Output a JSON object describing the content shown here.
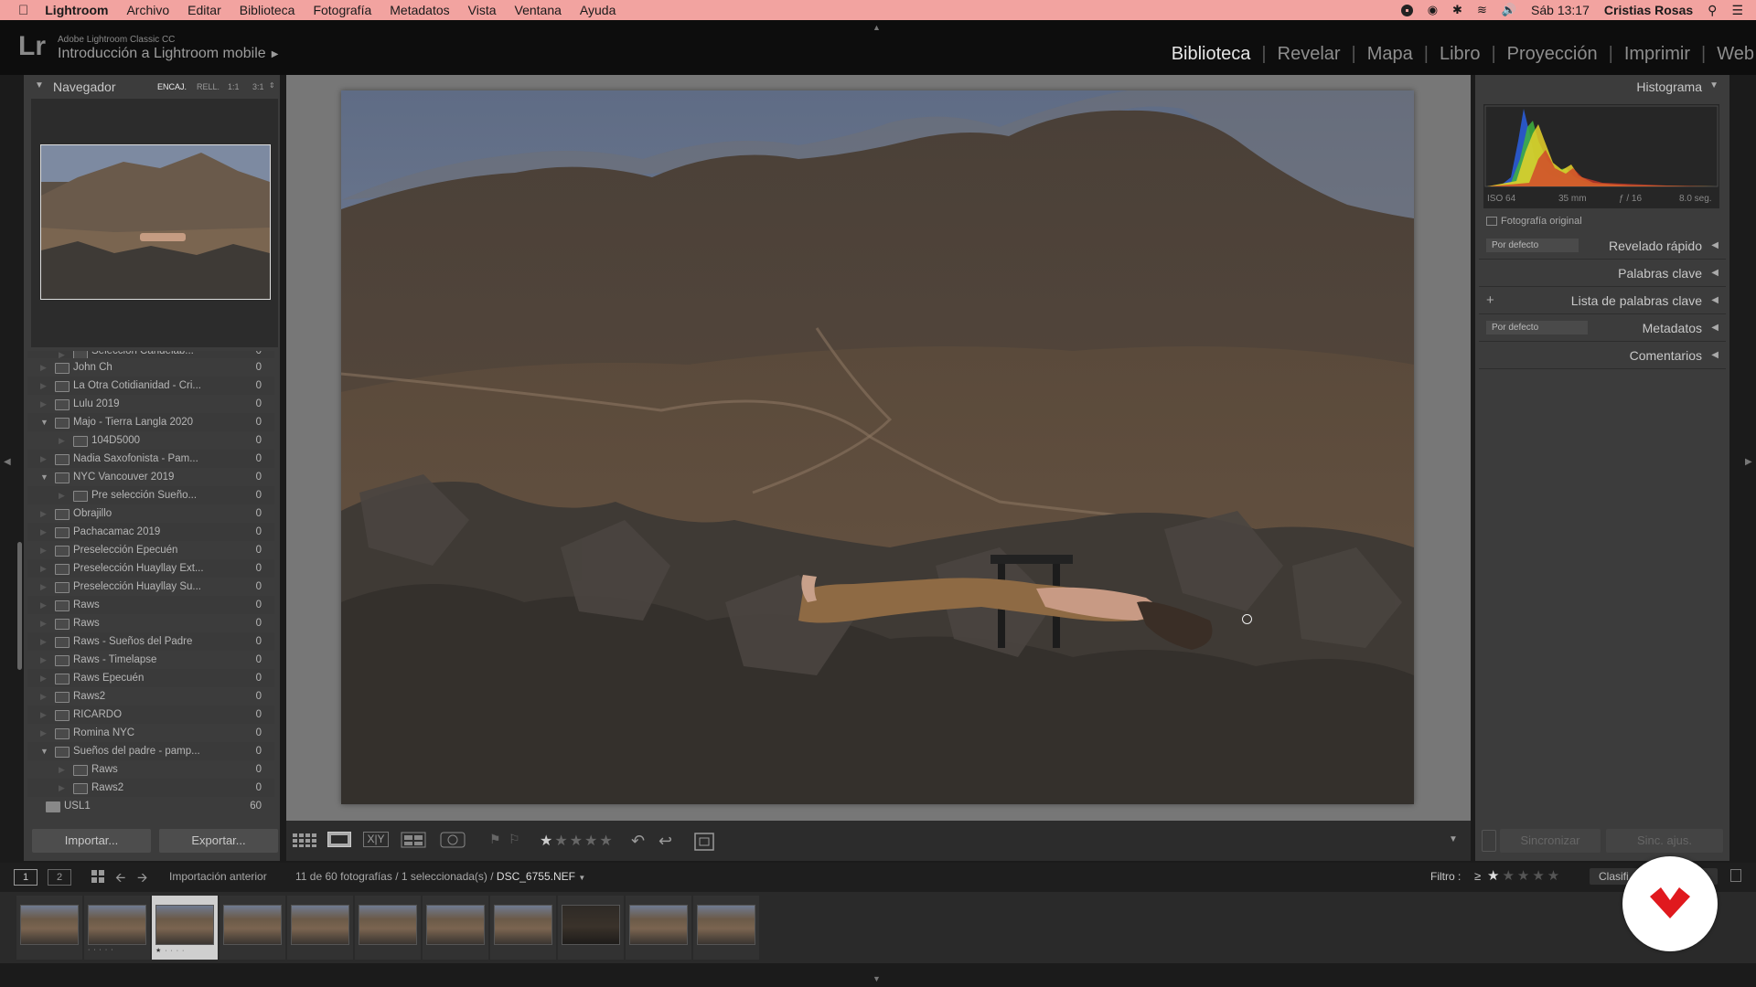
{
  "menubar": {
    "app_name": "Lightroom",
    "items": [
      "Archivo",
      "Editar",
      "Biblioteca",
      "Fotografía",
      "Metadatos",
      "Vista",
      "Ventana",
      "Ayuda"
    ],
    "clock": "Sáb 13:17",
    "user": "Cristias Rosas"
  },
  "header": {
    "logo": "Lr",
    "product": "Adobe Lightroom Classic CC",
    "catalog": "Introducción a Lightroom mobile",
    "modules": [
      "Biblioteca",
      "Revelar",
      "Mapa",
      "Libro",
      "Proyección",
      "Imprimir",
      "Web"
    ],
    "active_module": "Biblioteca"
  },
  "navigator": {
    "title": "Navegador",
    "zoom_options": [
      "ENCAJ.",
      "RELL.",
      "1:1",
      "3:1"
    ]
  },
  "folders": [
    {
      "name": "Selección Candelab...",
      "count": "0",
      "indent": 1,
      "expanded": false,
      "partial": true
    },
    {
      "name": "John Ch",
      "count": "0",
      "indent": 0,
      "expanded": false
    },
    {
      "name": "La Otra Cotidianidad - Cri...",
      "count": "0",
      "indent": 0,
      "expanded": false
    },
    {
      "name": "Lulu 2019",
      "count": "0",
      "indent": 0,
      "expanded": false
    },
    {
      "name": "Majo - Tierra Langla 2020",
      "count": "0",
      "indent": 0,
      "expanded": true
    },
    {
      "name": "104D5000",
      "count": "0",
      "indent": 1,
      "expanded": false
    },
    {
      "name": "Nadia Saxofonista - Pam...",
      "count": "0",
      "indent": 0,
      "expanded": false
    },
    {
      "name": "NYC Vancouver 2019",
      "count": "0",
      "indent": 0,
      "expanded": true
    },
    {
      "name": "Pre selección Sueño...",
      "count": "0",
      "indent": 1,
      "expanded": false
    },
    {
      "name": "Obrajillo",
      "count": "0",
      "indent": 0,
      "expanded": false
    },
    {
      "name": "Pachacamac 2019",
      "count": "0",
      "indent": 0,
      "expanded": false
    },
    {
      "name": "Preselección Epecuén",
      "count": "0",
      "indent": 0,
      "expanded": false
    },
    {
      "name": "Preselección Huayllay Ext...",
      "count": "0",
      "indent": 0,
      "expanded": false
    },
    {
      "name": "Preselección Huayllay Su...",
      "count": "0",
      "indent": 0,
      "expanded": false
    },
    {
      "name": "Raws",
      "count": "0",
      "indent": 0,
      "expanded": false
    },
    {
      "name": "Raws",
      "count": "0",
      "indent": 0,
      "expanded": false
    },
    {
      "name": "Raws - Sueños del Padre",
      "count": "0",
      "indent": 0,
      "expanded": false
    },
    {
      "name": "Raws - Timelapse",
      "count": "0",
      "indent": 0,
      "expanded": false
    },
    {
      "name": "Raws Epecuén",
      "count": "0",
      "indent": 0,
      "expanded": false
    },
    {
      "name": "Raws2",
      "count": "0",
      "indent": 0,
      "expanded": false
    },
    {
      "name": "RICARDO",
      "count": "0",
      "indent": 0,
      "expanded": false
    },
    {
      "name": "Romina NYC",
      "count": "0",
      "indent": 0,
      "expanded": false
    },
    {
      "name": "Sueños del padre - pamp...",
      "count": "0",
      "indent": 0,
      "expanded": true
    },
    {
      "name": "Raws",
      "count": "0",
      "indent": 1,
      "expanded": false
    },
    {
      "name": "Raws2",
      "count": "0",
      "indent": 1,
      "expanded": false
    },
    {
      "name": "USL1",
      "count": "60",
      "indent": -1,
      "expanded": false
    }
  ],
  "left_buttons": {
    "import": "Importar...",
    "export": "Exportar..."
  },
  "histogram": {
    "title": "Histograma",
    "iso": "ISO 64",
    "focal": "35 mm",
    "aperture": "ƒ / 16",
    "shutter": "8.0 seg.",
    "original_label": "Fotografía original"
  },
  "right_panels": [
    {
      "label": "Revelado rápido",
      "mini": "Por defecto"
    },
    {
      "label": "Palabras clave",
      "mini": ""
    },
    {
      "label": "Lista de palabras clave",
      "mini": "",
      "plus": "+"
    },
    {
      "label": "Metadatos",
      "mini": "Por defecto"
    },
    {
      "label": "Comentarios",
      "mini": ""
    }
  ],
  "right_buttons": {
    "sync": "Sincronizar",
    "sync_settings": "Sinc. ajus."
  },
  "filmstrip_bar": {
    "screen1": "1",
    "screen2": "2",
    "source": "Importación anterior",
    "status": "11 de 60 fotografías / 1 seleccionada(s) /",
    "filename": "DSC_6755.NEF",
    "filter_label": "Filtro :",
    "filter_op": "≥",
    "filter_value": "Clasifi"
  },
  "filmstrip": {
    "count": 11,
    "selected_index": 2,
    "stars": [
      "",
      "· · · · ·",
      "★ · · · ·",
      "",
      "",
      "",
      "",
      "",
      "",
      "",
      ""
    ]
  },
  "colors": {
    "menubar": "#f2a3a0",
    "panel": "#3c3c3c",
    "center_bg": "#777777",
    "accent_red": "#e0191e"
  }
}
